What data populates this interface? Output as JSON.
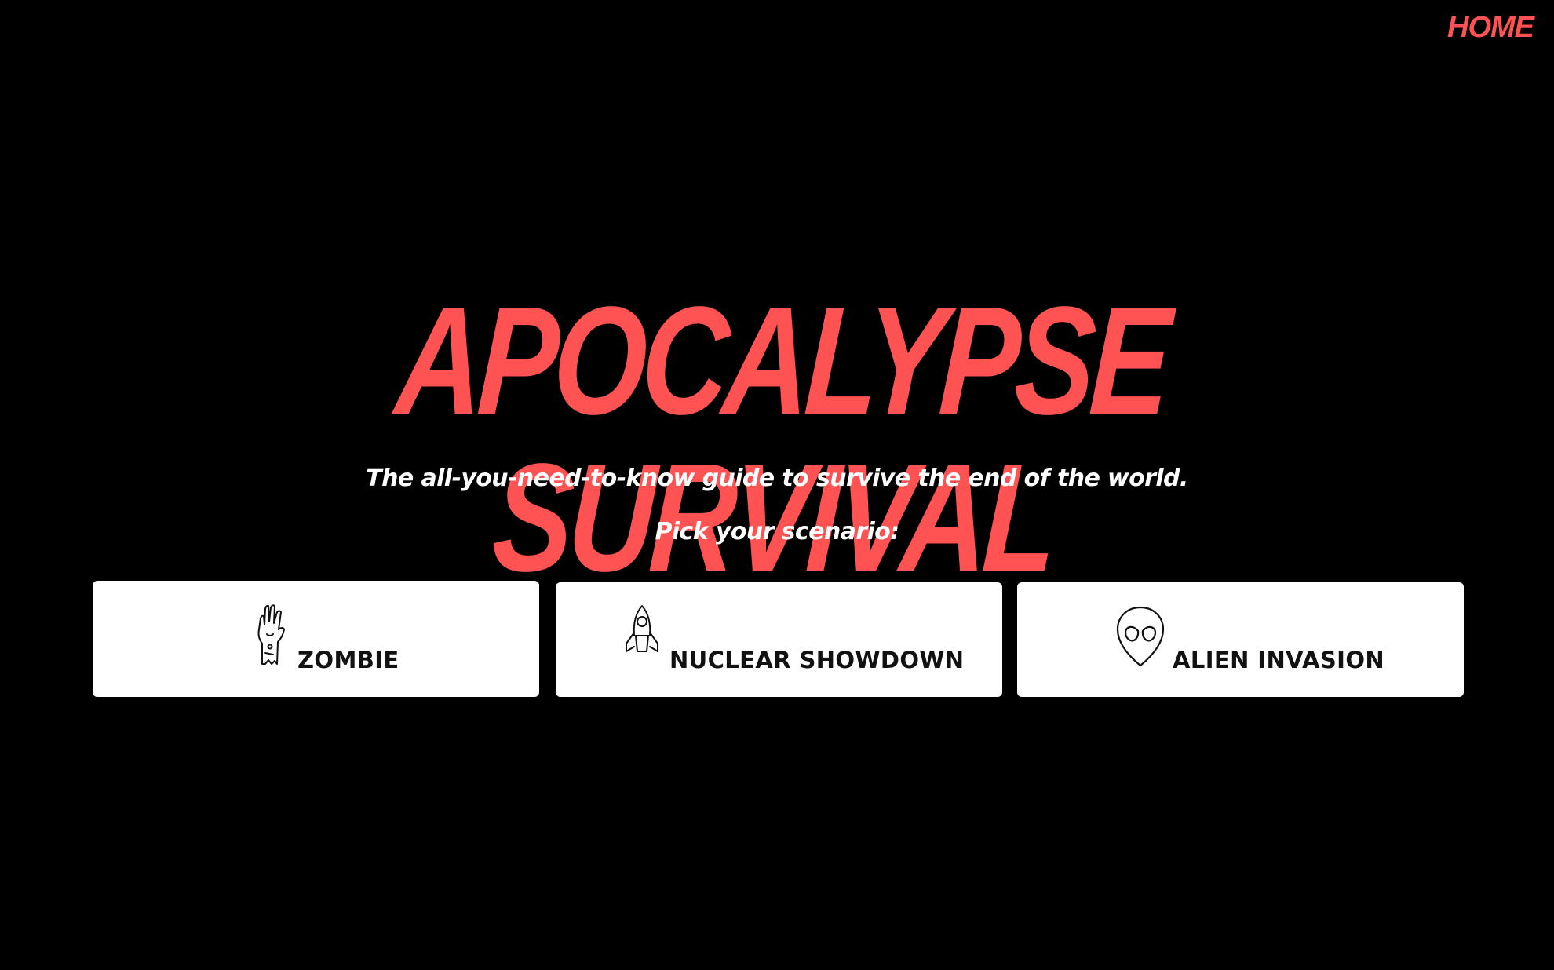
{
  "nav": {
    "home_label": "HOME"
  },
  "hero": {
    "title": "APOCALYPSE SURVIVAL",
    "tagline": "The all-you-need-to-know guide to survive the end of the world.",
    "prompt": "Pick your scenario:"
  },
  "scenarios": [
    {
      "label": "ZOMBIE",
      "icon": "zombie-hand-icon"
    },
    {
      "label": "NUCLEAR SHOWDOWN",
      "icon": "rocket-icon"
    },
    {
      "label": "ALIEN INVASION",
      "icon": "alien-head-icon"
    }
  ],
  "colors": {
    "accent": "#ff5252",
    "background": "#000000",
    "card": "#ffffff",
    "text": "#ffffff"
  }
}
